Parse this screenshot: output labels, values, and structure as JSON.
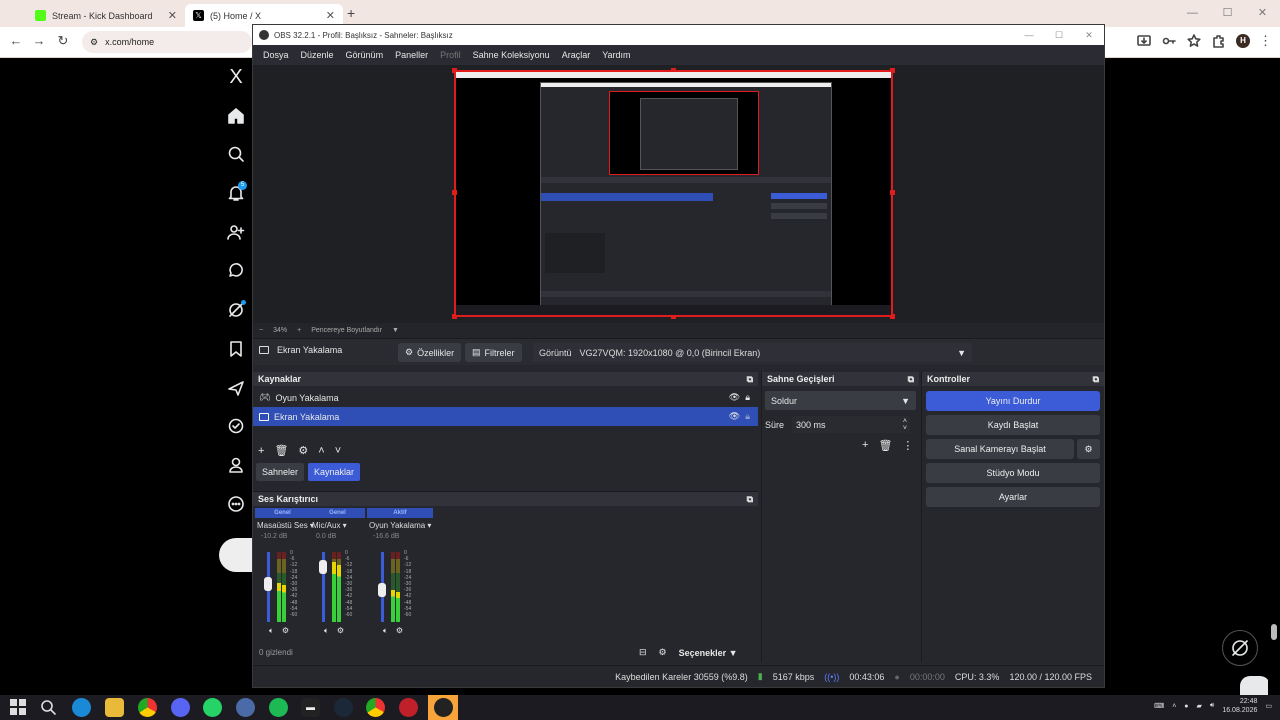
{
  "browser": {
    "tabs": [
      {
        "title": "Stream - Kick Dashboard",
        "favicon_color": "#53fc18"
      },
      {
        "title": "(5) Home / X",
        "favicon_color": "#000000"
      }
    ],
    "url": "x.com/home"
  },
  "x_sidebar": {
    "logo": "X",
    "notification_badge": "5",
    "icons": [
      "home-icon",
      "search-icon",
      "notifications-icon",
      "follow-icon",
      "messages-icon",
      "grok-icon",
      "bookmark-icon",
      "communities-icon",
      "verified-icon",
      "profile-icon",
      "more-icon"
    ]
  },
  "obs": {
    "title": "OBS 32.2.1 - Profil: Başlıksız - Sahneler: Başlıksız",
    "menu": [
      "Dosya",
      "Düzenle",
      "Görünüm",
      "Paneller",
      "Profil",
      "Sahne Koleksiyonu",
      "Araçlar",
      "Yardım"
    ],
    "zoom": "34%",
    "fit_label": "Pencereye Boyutlandır",
    "selected_source": "Ekran Yakalama",
    "properties_label": "Özellikler",
    "filters_label": "Filtreler",
    "display_label": "Görüntü",
    "display_value": "VG27VQM: 1920x1080 @ 0,0 (Birincil Ekran)",
    "sources": {
      "title": "Kaynaklar",
      "items": [
        {
          "name": "Oyun Yakalama"
        },
        {
          "name": "Ekran Yakalama"
        }
      ],
      "tab_scenes": "Sahneler",
      "tab_sources": "Kaynaklar"
    },
    "transitions": {
      "title": "Sahne Geçişleri",
      "type": "Soldur",
      "duration_label": "Süre",
      "duration": "300 ms"
    },
    "controls": {
      "title": "Kontroller",
      "stop_stream": "Yayını Durdur",
      "start_record": "Kaydı Başlat",
      "virtual_cam": "Sanal Kamerayı Başlat",
      "studio_mode": "Stüdyo Modu",
      "settings": "Ayarlar"
    },
    "mixer": {
      "title": "Ses Karıştırıcı",
      "hidden": "0 gizlendi",
      "options": "Seçenekler",
      "channels": [
        {
          "badge": "Genel",
          "name": "Masaüstü Ses",
          "db": "-10.2 dB",
          "level": 0.55
        },
        {
          "badge": "Genel",
          "name": "Mic/Aux",
          "db": "0.0 dB",
          "level": 0.85
        },
        {
          "badge": "Aktif",
          "name": "Oyun Yakalama",
          "db": "-16.6 dB",
          "level": 0.45
        }
      ],
      "scale": [
        "0",
        "-6",
        "-12",
        "-18",
        "-24",
        "-30",
        "-36",
        "-42",
        "-48",
        "-54",
        "-60"
      ]
    },
    "status": {
      "dropped": "Kaybedilen Kareler 30559 (%9.8)",
      "bitrate": "5167 kbps",
      "stream_time": "00:43:06",
      "rec_time": "00:00:00",
      "cpu": "CPU: 3.3%",
      "fps": "120.00 / 120.00 FPS"
    }
  },
  "taskbar": {
    "time": "22:48",
    "date": "16.08.2026"
  }
}
